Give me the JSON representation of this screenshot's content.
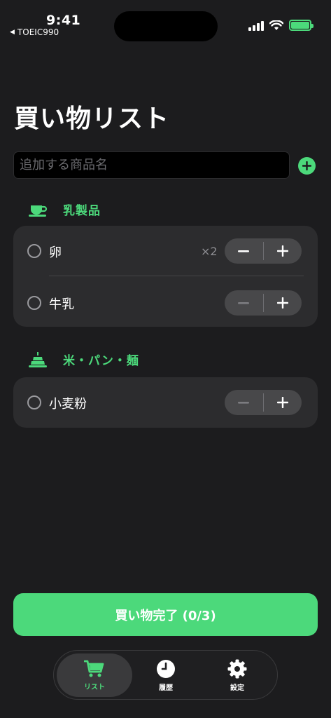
{
  "status_bar": {
    "time": "9:41",
    "back_app": "TOEIC990"
  },
  "page": {
    "title": "買い物リスト"
  },
  "add_item": {
    "placeholder": "追加する商品名"
  },
  "sections": [
    {
      "name": "乳製品",
      "icon": "coffee-cup-icon",
      "items": [
        {
          "name": "卵",
          "quantity": "×2"
        },
        {
          "name": "牛乳",
          "quantity": ""
        }
      ]
    },
    {
      "name": "米・パン・麺",
      "icon": "cake-icon",
      "items": [
        {
          "name": "小麦粉",
          "quantity": ""
        }
      ]
    }
  ],
  "footer": {
    "complete_label": "買い物完了 (0/3)"
  },
  "tabs": [
    {
      "label": "リスト",
      "icon": "cart-icon",
      "active": true
    },
    {
      "label": "履歴",
      "icon": "clock-icon",
      "active": false
    },
    {
      "label": "設定",
      "icon": "gear-icon",
      "active": false
    }
  ],
  "colors": {
    "accent": "#4cd97b",
    "background": "#1c1c1e",
    "card": "#2c2c2e"
  }
}
